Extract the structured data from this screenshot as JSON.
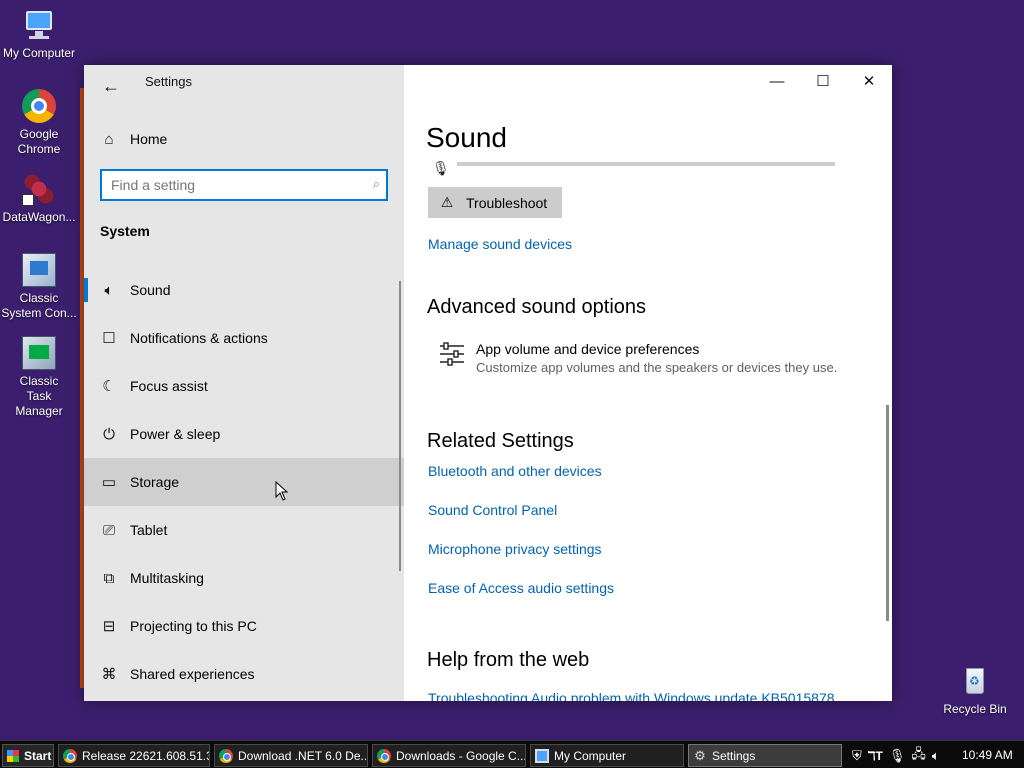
{
  "desktop": {
    "icons": [
      {
        "label": "My Computer",
        "icon": "computer-icon"
      },
      {
        "label": "Google Chrome",
        "icon": "chrome-icon"
      },
      {
        "label": "DataWagon...",
        "icon": "datawagon-icon"
      },
      {
        "label": "Classic System Con...",
        "icon": "control-panel-icon"
      },
      {
        "label": "Classic Task Manager",
        "icon": "task-manager-icon"
      },
      {
        "label": "Recycle Bin",
        "icon": "recycle-bin-icon"
      }
    ]
  },
  "window": {
    "app_title": "Settings",
    "back_icon": "back-arrow-icon",
    "caption": {
      "minimize": "—",
      "maximize": "☐",
      "close": "✕"
    }
  },
  "nav": {
    "home_label": "Home",
    "search": {
      "placeholder": "Find a setting",
      "value": ""
    },
    "section": "System",
    "items": [
      {
        "label": "Sound",
        "icon": "speaker-icon",
        "selected": true
      },
      {
        "label": "Notifications & actions",
        "icon": "notification-icon"
      },
      {
        "label": "Focus assist",
        "icon": "moon-icon"
      },
      {
        "label": "Power & sleep",
        "icon": "power-icon"
      },
      {
        "label": "Storage",
        "icon": "storage-icon",
        "hovered": true
      },
      {
        "label": "Tablet",
        "icon": "tablet-icon"
      },
      {
        "label": "Multitasking",
        "icon": "multitasking-icon"
      },
      {
        "label": "Projecting to this PC",
        "icon": "projector-icon"
      },
      {
        "label": "Shared experiences",
        "icon": "share-icon"
      }
    ]
  },
  "content": {
    "title": "Sound",
    "mic_level": 0,
    "troubleshoot_label": "Troubleshoot",
    "manage_devices_link": "Manage sound devices",
    "advanced_heading": "Advanced sound options",
    "app_volume": {
      "title": "App volume and device preferences",
      "description": "Customize app volumes and the speakers or devices they use."
    },
    "related_heading": "Related Settings",
    "related_links": [
      "Bluetooth and other devices",
      "Sound Control Panel",
      "Microphone privacy settings",
      "Ease of Access audio settings"
    ],
    "help_heading": "Help from the web",
    "help_link": "Troubleshooting Audio problem with Windows update KB5015878"
  },
  "taskbar": {
    "start_label": "Start",
    "tasks": [
      {
        "label": "Release 22621.608.51.3...",
        "icon": "chrome-icon"
      },
      {
        "label": "Download .NET 6.0 De...",
        "icon": "chrome-icon"
      },
      {
        "label": "Downloads - Google C...",
        "icon": "chrome-icon"
      },
      {
        "label": "My Computer",
        "icon": "computer-icon"
      },
      {
        "label": "Settings",
        "icon": "gear-icon",
        "active": true
      }
    ],
    "tray_icons": [
      "shield-icon",
      "language-icon",
      "microphone-icon",
      "network-icon",
      "volume-icon"
    ],
    "clock": "10:49 AM"
  },
  "colors": {
    "desktop": "#3b1f6e",
    "accent": "#0078d7",
    "link": "#0063b1",
    "nav_bg": "#e6e6e6"
  }
}
